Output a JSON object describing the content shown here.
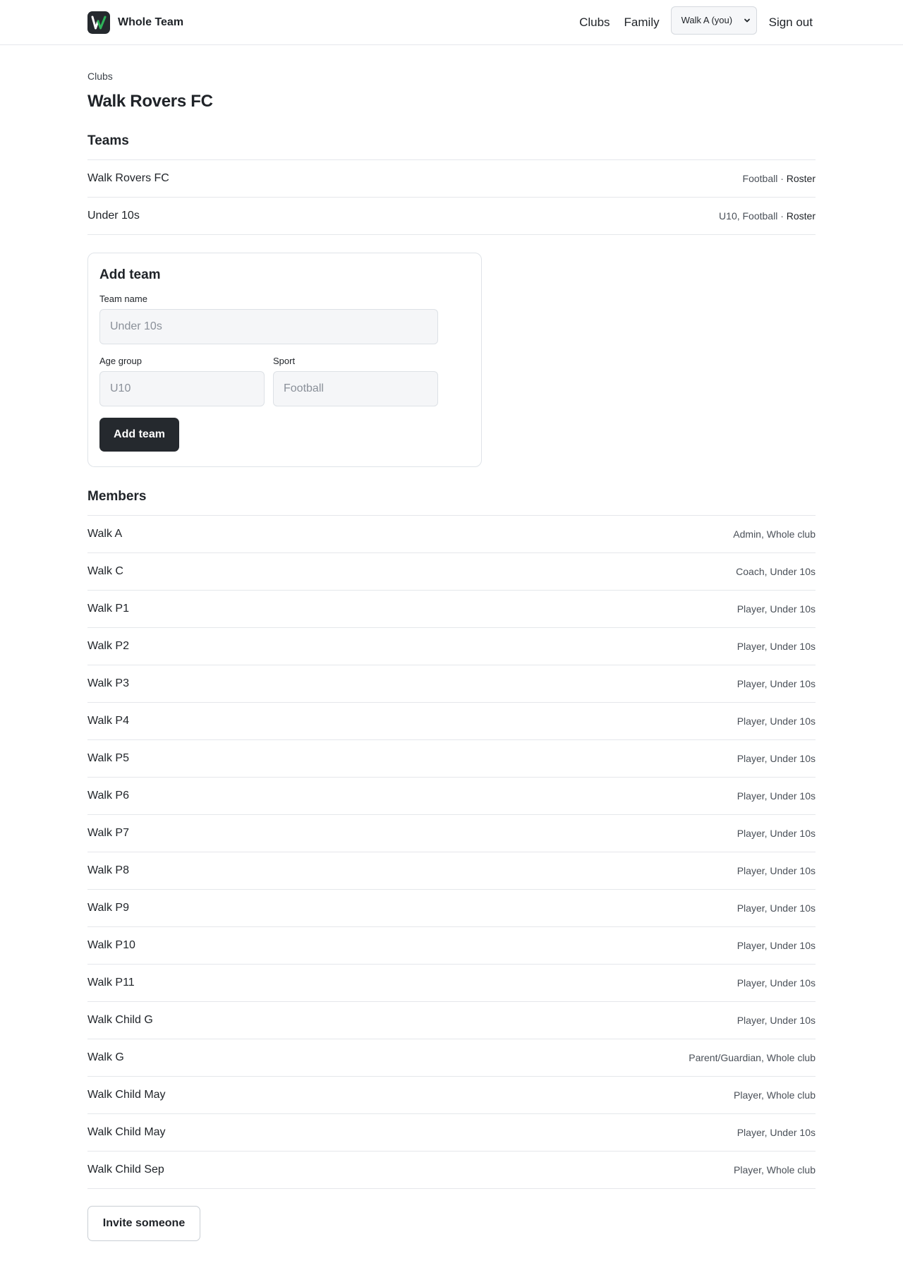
{
  "header": {
    "brand_name": "Whole Team",
    "nav": {
      "clubs": "Clubs",
      "family": "Family",
      "sign_out": "Sign out"
    },
    "user_select": {
      "selected": "Walk A (you)"
    }
  },
  "breadcrumb": "Clubs",
  "page_title": "Walk Rovers FC",
  "teams": {
    "title": "Teams",
    "items": [
      {
        "name": "Walk Rovers FC",
        "meta": "Football · ",
        "link": "Roster"
      },
      {
        "name": "Under 10s",
        "meta": "U10, Football · ",
        "link": "Roster"
      }
    ]
  },
  "add_team": {
    "title": "Add team",
    "team_name_label": "Team name",
    "team_name_placeholder": "Under 10s",
    "age_group_label": "Age group",
    "age_group_placeholder": "U10",
    "sport_label": "Sport",
    "sport_placeholder": "Football",
    "submit_label": "Add team"
  },
  "members": {
    "title": "Members",
    "items": [
      {
        "name": "Walk A",
        "role": "Admin, Whole club"
      },
      {
        "name": "Walk C",
        "role": "Coach, Under 10s"
      },
      {
        "name": "Walk P1",
        "role": "Player, Under 10s"
      },
      {
        "name": "Walk P2",
        "role": "Player, Under 10s"
      },
      {
        "name": "Walk P3",
        "role": "Player, Under 10s"
      },
      {
        "name": "Walk P4",
        "role": "Player, Under 10s"
      },
      {
        "name": "Walk P5",
        "role": "Player, Under 10s"
      },
      {
        "name": "Walk P6",
        "role": "Player, Under 10s"
      },
      {
        "name": "Walk P7",
        "role": "Player, Under 10s"
      },
      {
        "name": "Walk P8",
        "role": "Player, Under 10s"
      },
      {
        "name": "Walk P9",
        "role": "Player, Under 10s"
      },
      {
        "name": "Walk P10",
        "role": "Player, Under 10s"
      },
      {
        "name": "Walk P11",
        "role": "Player, Under 10s"
      },
      {
        "name": "Walk Child G",
        "role": "Player, Under 10s"
      },
      {
        "name": "Walk G",
        "role": "Parent/Guardian, Whole club"
      },
      {
        "name": "Walk Child May",
        "role": "Player, Whole club"
      },
      {
        "name": "Walk Child May",
        "role": "Player, Under 10s"
      },
      {
        "name": "Walk Child Sep",
        "role": "Player, Whole club"
      }
    ],
    "invite_label": "Invite someone"
  }
}
